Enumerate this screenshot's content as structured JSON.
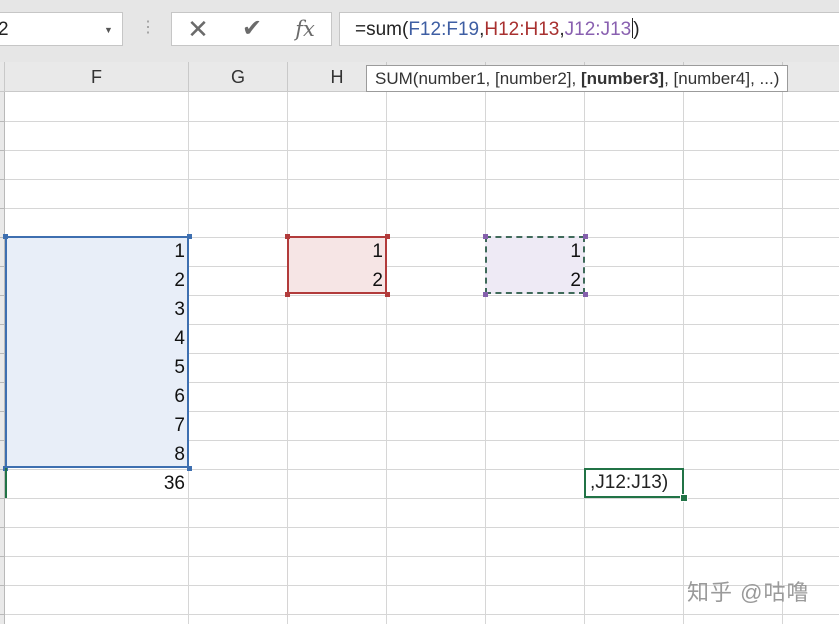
{
  "formula_bar": {
    "name_box": "2",
    "fx_label": "fx",
    "formula": {
      "prefix": "=sum(",
      "ref1": "F12:F19",
      "sep1": ",",
      "ref2": "H12:H13",
      "sep2": ",",
      "ref3": "J12:J13",
      "suffix": ")"
    }
  },
  "columns": [
    {
      "id": "col-f",
      "label": "F"
    },
    {
      "id": "col-g",
      "label": "G"
    },
    {
      "id": "col-h",
      "label": "H"
    }
  ],
  "tooltip": {
    "prefix": "SUM(number1, [number2], ",
    "bold": "[number3]",
    "suffix": ", [number4], ...)"
  },
  "ranges": {
    "F12:F19": {
      "values": [
        "1",
        "2",
        "3",
        "4",
        "5",
        "6",
        "7",
        "8"
      ],
      "color": "#3e6fb0",
      "fill": "#e8eef8"
    },
    "H12:H13": {
      "values": [
        "1",
        "2"
      ],
      "color": "#b23b3b",
      "fill": "#f6e5e5"
    },
    "J12:J13": {
      "values": [
        "1",
        "2"
      ],
      "color": "#8560ad",
      "fill": "#eeeaf5"
    }
  },
  "total": "36",
  "active_cell_text": ",J12:J13)",
  "watermark": "知乎 @咕噜",
  "colors": {
    "accent_green": "#217346",
    "ref_blue": "#3e5ea3",
    "ref_red": "#a8302f",
    "ref_purple": "#8960b0"
  }
}
